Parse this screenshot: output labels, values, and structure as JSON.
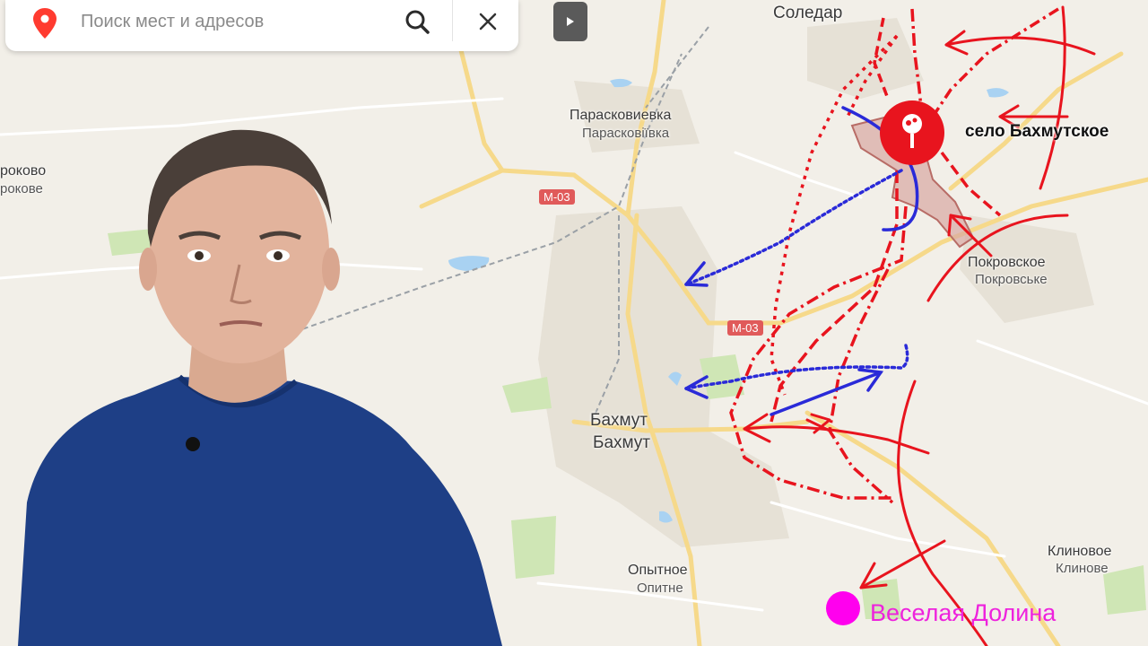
{
  "search": {
    "placeholder": "Поиск мест и адресов",
    "search_icon": "search-icon",
    "close_icon": "close-icon",
    "pin_icon": "map-pin-icon",
    "play_icon": "play-icon"
  },
  "places": {
    "soledar": "Соледар",
    "paraskovievka_ru": "Парасковиевка",
    "paraskovievka_ua": "Парасковіївка",
    "krasnoe_ru": "роково",
    "krasnoe_ua": "рокове",
    "bakhmutskoe": "село Бахмутское",
    "pokrovskoe_ru": "Покровское",
    "pokrovskoe_ua": "Покровське",
    "bakhmut_ru": "Бахмут",
    "bakhmut_ua": "Бахмут",
    "opytnoe_ru": "Опытное",
    "opytnoe_ua": "Опитне",
    "klinovoe_ru": "Клиновое",
    "klinovoe_ua": "Клинове",
    "veselaya_dolina": "Веселая Долина"
  },
  "roads": {
    "m03_top": "М-03",
    "m03_mid": "М-03"
  },
  "colors": {
    "map_bg": "#f2efe8",
    "road_yellow": "#f6d98a",
    "arrow_red": "#e8141e",
    "arrow_blue": "#2a2ad8",
    "marker_pink": "#ff00ee",
    "water": "#a9d2f2",
    "forest": "#cfe6b5",
    "sweater": "#1e3f86"
  }
}
